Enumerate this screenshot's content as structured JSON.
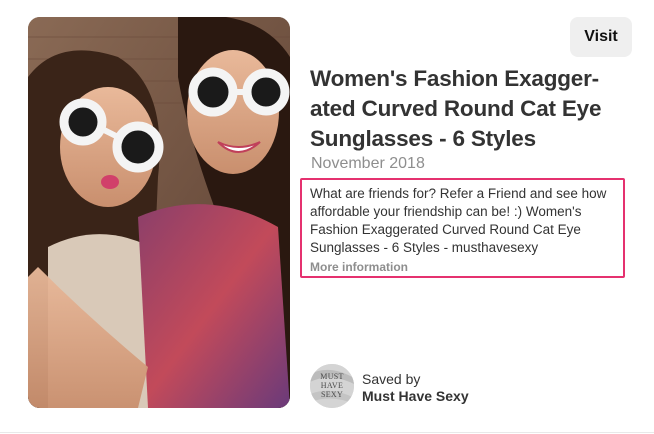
{
  "visit_button": {
    "label": "Visit"
  },
  "pin": {
    "title_lines": [
      "Women's Fashion Exagger-",
      "ated Curved Round Cat Eye",
      "Sunglasses - 6 Styles"
    ],
    "date": "November 2018",
    "description_lines": [
      "What are friends for? Refer a Friend and see how",
      "affordable your friendship can be! :) Women's",
      "Fashion Exaggerated Curved Round Cat Eye",
      "Sunglasses - 6 Styles - musthavesexy"
    ],
    "more_info_label": "More information"
  },
  "saved_by": {
    "label": "Saved by",
    "name": "Must Have Sexy",
    "avatar_lines": [
      "MUST",
      "HAVE",
      "SEXY"
    ]
  },
  "colors": {
    "highlight_border": "#e5316f",
    "visit_button_bg": "#efefef",
    "muted_text": "#8e8e8e"
  },
  "icons": {
    "pin_image": "photo-two-women-cat-eye-sunglasses"
  }
}
